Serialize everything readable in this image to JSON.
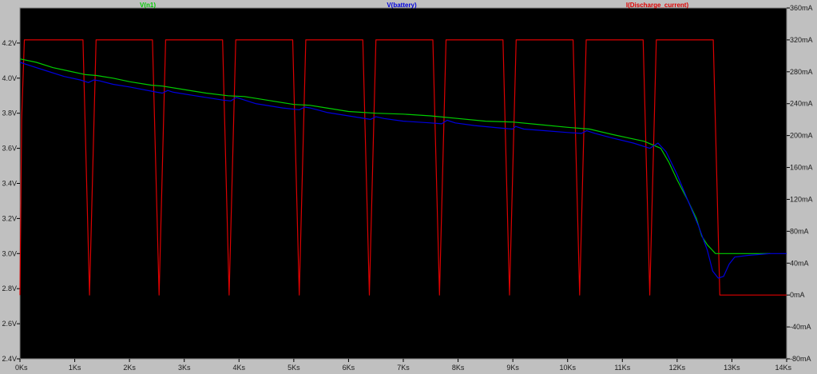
{
  "chart_data": {
    "type": "line",
    "background": "#000000",
    "frame_color": "#c0c0c0",
    "grid": false,
    "legend_position": "top",
    "x": {
      "range": [
        0,
        14000
      ],
      "ticks": [
        0,
        1000,
        2000,
        3000,
        4000,
        5000,
        6000,
        7000,
        8000,
        9000,
        10000,
        11000,
        12000,
        13000,
        14000
      ],
      "tick_labels": [
        "0Ks",
        "1Ks",
        "2Ks",
        "3Ks",
        "4Ks",
        "5Ks",
        "6Ks",
        "7Ks",
        "8Ks",
        "9Ks",
        "10Ks",
        "11Ks",
        "12Ks",
        "13Ks",
        "14Ks"
      ]
    },
    "y_left": {
      "range": [
        2.4,
        4.4
      ],
      "tick_values": [
        2.4,
        2.6,
        2.8,
        3.0,
        3.2,
        3.4,
        3.6,
        3.8,
        4.0,
        4.2
      ],
      "tick_labels": [
        "2.4V",
        "2.6V",
        "2.8V",
        "3.0V",
        "3.2V",
        "3.4V",
        "3.6V",
        "3.8V",
        "4.0V",
        "4.2V"
      ]
    },
    "y_right": {
      "range": [
        -80,
        360
      ],
      "tick_values": [
        -80,
        -40,
        0,
        40,
        80,
        120,
        160,
        200,
        240,
        280,
        320,
        360
      ],
      "tick_labels": [
        "-80mA",
        "-40mA",
        "0mA",
        "40mA",
        "80mA",
        "120mA",
        "160mA",
        "200mA",
        "240mA",
        "280mA",
        "320mA",
        "360mA"
      ]
    },
    "series": [
      {
        "name": "V(n1)",
        "color": "#00cc00",
        "axis": "left",
        "points": [
          [
            0,
            4.11
          ],
          [
            300,
            4.09
          ],
          [
            600,
            4.06
          ],
          [
            900,
            4.04
          ],
          [
            1200,
            4.02
          ],
          [
            1400,
            4.015
          ],
          [
            1700,
            4.0
          ],
          [
            2000,
            3.98
          ],
          [
            2400,
            3.96
          ],
          [
            2600,
            3.955
          ],
          [
            3000,
            3.935
          ],
          [
            3400,
            3.915
          ],
          [
            3800,
            3.9
          ],
          [
            4100,
            3.895
          ],
          [
            4500,
            3.875
          ],
          [
            5000,
            3.85
          ],
          [
            5300,
            3.845
          ],
          [
            5600,
            3.83
          ],
          [
            6000,
            3.81
          ],
          [
            6500,
            3.8
          ],
          [
            7000,
            3.795
          ],
          [
            7500,
            3.785
          ],
          [
            8000,
            3.77
          ],
          [
            8500,
            3.755
          ],
          [
            9000,
            3.75
          ],
          [
            9500,
            3.735
          ],
          [
            10000,
            3.72
          ],
          [
            10400,
            3.71
          ],
          [
            10800,
            3.68
          ],
          [
            11100,
            3.66
          ],
          [
            11400,
            3.64
          ],
          [
            11550,
            3.62
          ],
          [
            11700,
            3.6
          ],
          [
            11850,
            3.52
          ],
          [
            12000,
            3.42
          ],
          [
            12200,
            3.3
          ],
          [
            12350,
            3.2
          ],
          [
            12450,
            3.1
          ],
          [
            12550,
            3.05
          ],
          [
            12700,
            3.0
          ],
          [
            13000,
            3.0
          ],
          [
            13500,
            3.0
          ],
          [
            13700,
            3.0
          ]
        ]
      },
      {
        "name": "V(battery)",
        "color": "#0000dd",
        "axis": "left",
        "points": [
          [
            0,
            4.09
          ],
          [
            200,
            4.07
          ],
          [
            500,
            4.04
          ],
          [
            800,
            4.01
          ],
          [
            1100,
            3.99
          ],
          [
            1250,
            3.975
          ],
          [
            1350,
            3.99
          ],
          [
            1450,
            3.985
          ],
          [
            1700,
            3.965
          ],
          [
            2000,
            3.95
          ],
          [
            2500,
            3.92
          ],
          [
            2600,
            3.915
          ],
          [
            2700,
            3.93
          ],
          [
            2800,
            3.92
          ],
          [
            3200,
            3.9
          ],
          [
            3700,
            3.875
          ],
          [
            3850,
            3.87
          ],
          [
            3950,
            3.89
          ],
          [
            4050,
            3.88
          ],
          [
            4300,
            3.855
          ],
          [
            4800,
            3.83
          ],
          [
            5100,
            3.82
          ],
          [
            5200,
            3.835
          ],
          [
            5300,
            3.83
          ],
          [
            5600,
            3.805
          ],
          [
            6000,
            3.785
          ],
          [
            6400,
            3.765
          ],
          [
            6500,
            3.78
          ],
          [
            6650,
            3.77
          ],
          [
            7000,
            3.755
          ],
          [
            7500,
            3.745
          ],
          [
            7700,
            3.74
          ],
          [
            7800,
            3.76
          ],
          [
            7950,
            3.745
          ],
          [
            8300,
            3.73
          ],
          [
            8800,
            3.715
          ],
          [
            9000,
            3.71
          ],
          [
            9050,
            3.725
          ],
          [
            9200,
            3.71
          ],
          [
            9600,
            3.7
          ],
          [
            10000,
            3.69
          ],
          [
            10250,
            3.685
          ],
          [
            10350,
            3.7
          ],
          [
            10500,
            3.685
          ],
          [
            10800,
            3.66
          ],
          [
            11200,
            3.63
          ],
          [
            11500,
            3.6
          ],
          [
            11650,
            3.63
          ],
          [
            11800,
            3.58
          ],
          [
            12000,
            3.45
          ],
          [
            12200,
            3.3
          ],
          [
            12400,
            3.15
          ],
          [
            12550,
            3.02
          ],
          [
            12650,
            2.9
          ],
          [
            12750,
            2.86
          ],
          [
            12850,
            2.87
          ],
          [
            12950,
            2.94
          ],
          [
            13050,
            2.98
          ],
          [
            13300,
            2.99
          ],
          [
            13700,
            3.0
          ],
          [
            14000,
            3.0
          ]
        ]
      },
      {
        "name": "I(Discharge_current)",
        "color": "#dd0000",
        "axis": "right",
        "points": [
          [
            0,
            0
          ],
          [
            30,
            220
          ],
          [
            80,
            320
          ],
          [
            1150,
            320
          ],
          [
            1270,
            0
          ],
          [
            1390,
            320
          ],
          [
            2420,
            320
          ],
          [
            2540,
            0
          ],
          [
            2660,
            320
          ],
          [
            3700,
            320
          ],
          [
            3820,
            0
          ],
          [
            3940,
            320
          ],
          [
            4980,
            320
          ],
          [
            5100,
            0
          ],
          [
            5220,
            320
          ],
          [
            6260,
            320
          ],
          [
            6380,
            0
          ],
          [
            6500,
            320
          ],
          [
            7540,
            320
          ],
          [
            7660,
            0
          ],
          [
            7780,
            320
          ],
          [
            8820,
            320
          ],
          [
            8940,
            0
          ],
          [
            9060,
            320
          ],
          [
            10100,
            320
          ],
          [
            10220,
            0
          ],
          [
            10340,
            320
          ],
          [
            11380,
            320
          ],
          [
            11500,
            0
          ],
          [
            11620,
            320
          ],
          [
            12660,
            320
          ],
          [
            12780,
            0
          ],
          [
            14000,
            0
          ]
        ]
      }
    ]
  }
}
